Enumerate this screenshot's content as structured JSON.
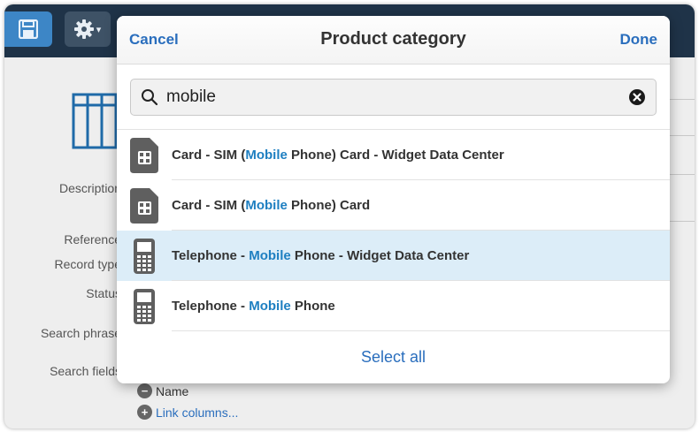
{
  "toolbar": {
    "save_icon": "floppy-disk-icon",
    "settings_icon": "gear-icon",
    "settings_caret": "▾"
  },
  "background_form": {
    "labels": {
      "description": "Description",
      "reference": "Reference",
      "record_type": "Record type",
      "status": "Status",
      "search_phrase": "Search phrase",
      "search_fields": "Search fields"
    },
    "name_item": "Name",
    "link_columns": "Link columns..."
  },
  "modal": {
    "cancel_label": "Cancel",
    "title": "Product category",
    "done_label": "Done",
    "search": {
      "value": "mobile",
      "placeholder": ""
    },
    "results": [
      {
        "prefix": "Card - SIM (",
        "match": "Mobile",
        "suffix": " Phone) Card - Widget Data Center",
        "icon": "sim-card-icon",
        "selected": false
      },
      {
        "prefix": "Card - SIM (",
        "match": "Mobile",
        "suffix": " Phone) Card",
        "icon": "sim-card-icon",
        "selected": false
      },
      {
        "prefix": "Telephone - ",
        "match": "Mobile",
        "suffix": " Phone - Widget Data Center",
        "icon": "mobile-phone-icon",
        "selected": true
      },
      {
        "prefix": "Telephone - ",
        "match": "Mobile",
        "suffix": " Phone",
        "icon": "mobile-phone-icon",
        "selected": false
      }
    ],
    "select_all_label": "Select all"
  },
  "colors": {
    "accent": "#2a6ebd",
    "highlight": "#1e7fc1",
    "selected_row": "#dcedf8",
    "topbar": "#1f3348"
  }
}
